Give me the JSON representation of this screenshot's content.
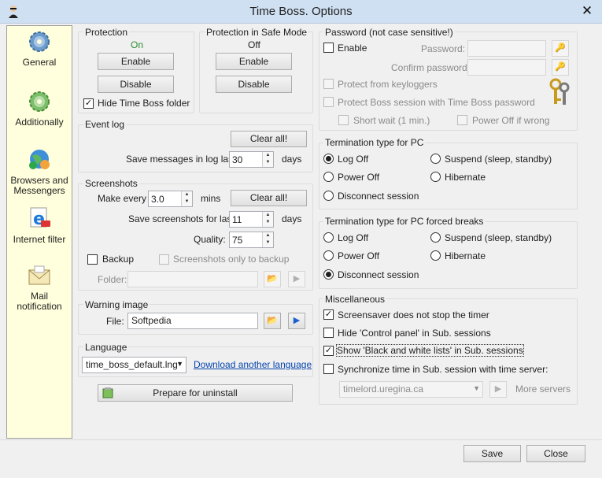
{
  "window": {
    "title": "Time Boss. Options",
    "close_glyph": "✕"
  },
  "sidebar": {
    "items": [
      {
        "label": "General",
        "icon": "gear-icon"
      },
      {
        "label": "Additionally",
        "icon": "gear-green-icon"
      },
      {
        "label": "Browsers and Messengers",
        "icon": "globe-icon"
      },
      {
        "label": "Internet filter",
        "icon": "internet-explorer-icon"
      },
      {
        "label": "Mail notification",
        "icon": "envelope-icon"
      }
    ]
  },
  "protection": {
    "title": "Protection",
    "status": "On",
    "enable": "Enable",
    "disable": "Disable",
    "hide_folder": "Hide Time Boss folder"
  },
  "safe_mode": {
    "title": "Protection in Safe Mode",
    "status": "Off",
    "enable": "Enable",
    "disable": "Disable"
  },
  "event_log": {
    "title": "Event log",
    "clear": "Clear all!",
    "save_label": "Save messages in log last",
    "days_value": "30",
    "days_unit": "days"
  },
  "screenshots": {
    "title": "Screenshots",
    "make_every": "Make every",
    "interval": "3.0",
    "mins": "mins",
    "clear": "Clear all!",
    "save_label": "Save screenshots for last",
    "days_value": "11",
    "days_unit": "days",
    "quality_label": "Quality:",
    "quality": "75",
    "backup": "Backup",
    "only_backup": "Screenshots only to backup",
    "folder_label": "Folder:",
    "folder_value": ""
  },
  "warning": {
    "title": "Warning image",
    "file_label": "File:",
    "file_value": "Softpedia"
  },
  "language": {
    "title": "Language",
    "selected": "time_boss_default.lng",
    "download": "Download another language"
  },
  "uninstall": {
    "label": "Prepare for uninstall"
  },
  "password": {
    "title": "Password (not case sensitive!)",
    "enable": "Enable",
    "password_label": "Password:",
    "confirm_label": "Confirm password:",
    "keyloggers": "Protect from keyloggers",
    "boss_session": "Protect Boss session with Time Boss password",
    "short_wait": "Short wait (1 min.)",
    "power_off": "Power Off if wrong"
  },
  "termination": {
    "title": "Termination type for PC",
    "options": [
      "Log Off",
      "Suspend (sleep, standby)",
      "Power Off",
      "Hibernate",
      "Disconnect session"
    ],
    "selected": "Log Off"
  },
  "termination_forced": {
    "title": "Termination type for PC forced breaks",
    "options": [
      "Log Off",
      "Suspend (sleep, standby)",
      "Power Off",
      "Hibernate",
      "Disconnect session"
    ],
    "selected": "Disconnect session"
  },
  "misc": {
    "title": "Miscellaneous",
    "items": [
      {
        "label": "Screensaver does not stop the timer",
        "checked": true
      },
      {
        "label": "Hide 'Control panel' in Sub. sessions",
        "checked": false
      },
      {
        "label": "Show 'Black and white lists' in Sub. sessions",
        "checked": true
      },
      {
        "label": "Synchronize time in Sub. session with time server:",
        "checked": false
      }
    ],
    "server": "timelord.uregina.ca",
    "more_servers": "More servers"
  },
  "footer": {
    "save": "Save",
    "close": "Close"
  }
}
